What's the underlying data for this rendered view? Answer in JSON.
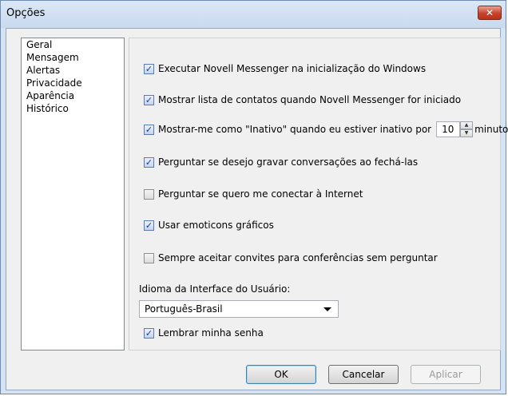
{
  "window": {
    "title": "Opções",
    "close_label": "✕"
  },
  "sidebar": {
    "items": [
      {
        "label": "Geral",
        "selected": true
      },
      {
        "label": "Mensagem",
        "selected": false
      },
      {
        "label": "Alertas",
        "selected": false
      },
      {
        "label": "Privacidade",
        "selected": false
      },
      {
        "label": "Aparência",
        "selected": false
      },
      {
        "label": "Histórico",
        "selected": false
      }
    ]
  },
  "options": [
    {
      "label": "Executar Novell Messenger na inicialização do Windows",
      "checked": true
    },
    {
      "label": "Mostrar lista de contatos quando Novell Messenger for iniciado",
      "checked": true
    },
    {
      "label": "Mostrar-me como \"Inativo\" quando eu estiver inativo por",
      "checked": true
    },
    {
      "label": "Perguntar se desejo gravar conversações ao fechá-las",
      "checked": true
    },
    {
      "label": "Perguntar se quero me conectar à Internet",
      "checked": false
    },
    {
      "label": "Usar emoticons gráficos",
      "checked": true
    },
    {
      "label": "Sempre aceitar convites para conferências sem perguntar",
      "checked": false
    }
  ],
  "inactive_spinner": {
    "value": "10",
    "unit": "minuto"
  },
  "language": {
    "label": "Idioma da Interface do Usuário:",
    "selected": "Português-Brasil"
  },
  "remember_password": {
    "label": "Lembrar minha senha",
    "checked": true
  },
  "buttons": {
    "ok": "OK",
    "cancel": "Cancelar",
    "apply": "Aplicar"
  },
  "check_glyph": "✓"
}
